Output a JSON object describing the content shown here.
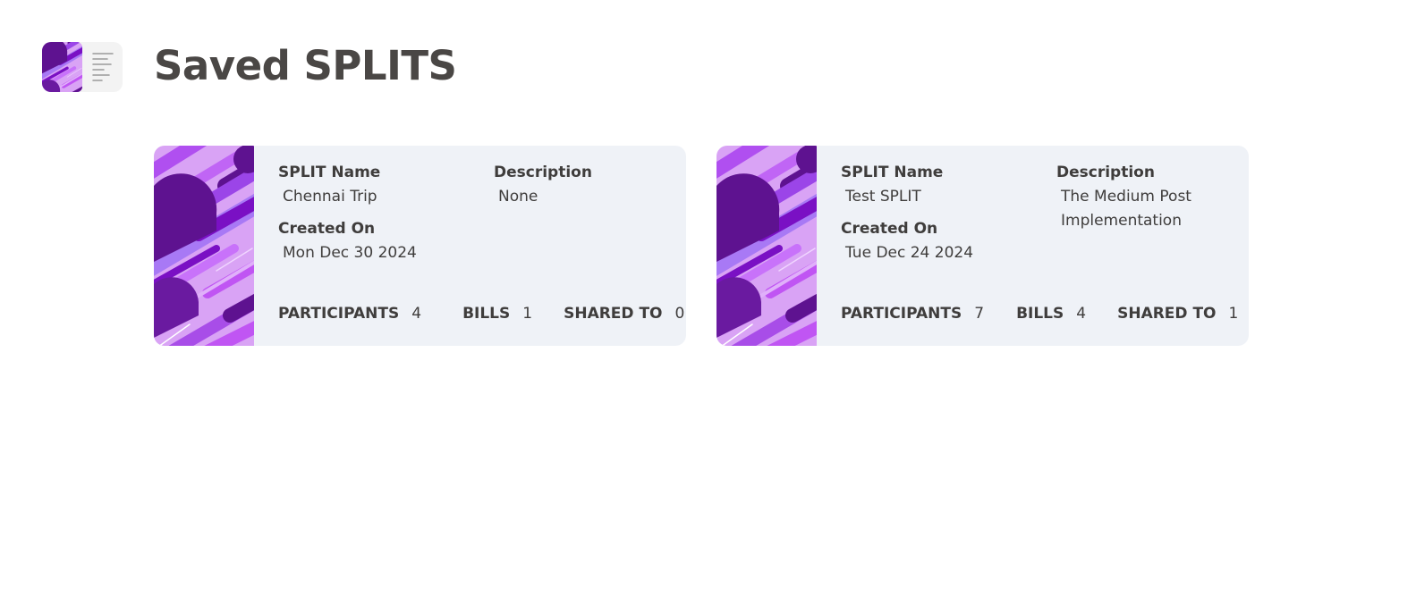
{
  "header": {
    "title": "Saved SPLITS",
    "logo_icon": "abstract-purple-pattern-icon",
    "menu_icon": "menu-lines-icon"
  },
  "colors": {
    "accent_purple": "#8a2be2",
    "card_background": "#eff2f7",
    "text": "#3f3d3c"
  },
  "splits": [
    {
      "name_label": "SPLIT Name",
      "name": "Chennai Trip",
      "description_label": "Description",
      "description": "None",
      "created_label": "Created On",
      "created": "Mon Dec 30 2024",
      "participants_label": "PARTICIPANTS",
      "participants": "4",
      "bills_label": "BILLS",
      "bills": "1",
      "shared_label": "SHARED TO",
      "shared": "0"
    },
    {
      "name_label": "SPLIT Name",
      "name": "Test SPLIT",
      "description_label": "Description",
      "description": "The Medium Post Implementation",
      "created_label": "Created On",
      "created": "Tue Dec 24 2024",
      "participants_label": "PARTICIPANTS",
      "participants": "7",
      "bills_label": "BILLS",
      "bills": "4",
      "shared_label": "SHARED TO",
      "shared": "1"
    }
  ]
}
